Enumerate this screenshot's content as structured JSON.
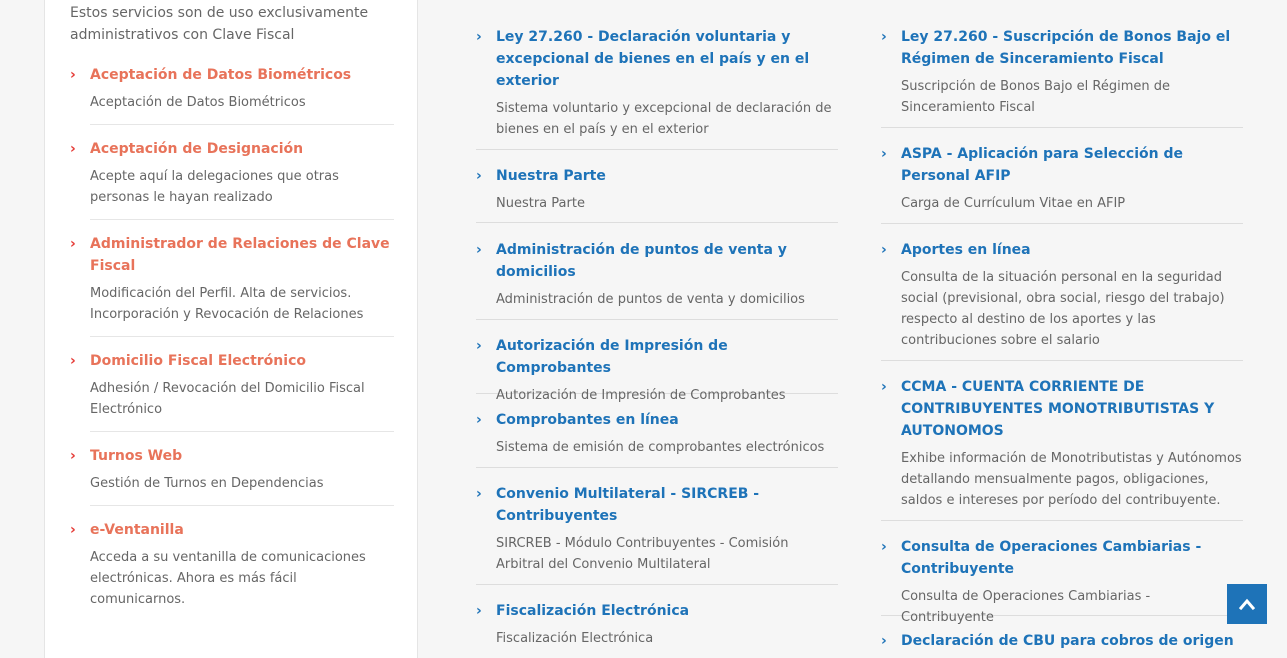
{
  "left_panel": {
    "intro": "Estos servicios son de uso exclusivamente administrativos con Clave Fiscal",
    "items": [
      {
        "title": "Aceptación de Datos Biométricos",
        "desc": "Aceptación de Datos Biométricos"
      },
      {
        "title": "Aceptación de Designación",
        "desc": "Acepte aquí la delegaciones que otras personas le hayan realizado"
      },
      {
        "title": "Administrador de Relaciones de Clave Fiscal",
        "desc": "Modificación del Perfil. Alta de servicios. Incorporación y Revocación de Relaciones"
      },
      {
        "title": "Domicilio Fiscal Electrónico",
        "desc": "Adhesión / Revocación del Domicilio Fiscal Electrónico"
      },
      {
        "title": "Turnos Web",
        "desc": "Gestión de Turnos en Dependencias"
      },
      {
        "title": "e-Ventanilla",
        "desc": "Acceda a su ventanilla de comunicaciones electrónicas. Ahora es más fácil comunicarnos."
      }
    ]
  },
  "middle_column": {
    "items": [
      {
        "title": "Ley 27.260 - Declaración voluntaria y excepcional de bienes en el país y en el exterior",
        "desc": "Sistema voluntario y excepcional de declaración de bienes en el país y en el exterior"
      },
      {
        "title": "Nuestra Parte",
        "desc": "Nuestra Parte"
      },
      {
        "title": "Administración de puntos de venta y domicilios",
        "desc": "Administración de puntos de venta y domicilios"
      },
      {
        "title": "Autorización de Impresión de Comprobantes",
        "desc": "Autorización de Impresión de Comprobantes"
      },
      {
        "title": "Comprobantes en línea",
        "desc": "Sistema de emisión de comprobantes electrónicos"
      },
      {
        "title": "Convenio Multilateral - SIRCREB - Contribuyentes",
        "desc": "SIRCREB - Módulo Contribuyentes - Comisión Arbitral del Convenio Multilateral"
      },
      {
        "title": "Fiscalización Electrónica",
        "desc": "Fiscalización Electrónica"
      }
    ]
  },
  "right_column": {
    "items": [
      {
        "title": "Ley 27.260 - Suscripción de Bonos Bajo el Régimen de Sinceramiento Fiscal",
        "desc": "Suscripción de Bonos Bajo el Régimen de Sinceramiento Fiscal"
      },
      {
        "title": "ASPA - Aplicación para Selección de Personal AFIP",
        "desc": "Carga de Currículum Vitae en AFIP"
      },
      {
        "title": "Aportes en línea",
        "desc": "Consulta de la situación personal en la seguridad social (previsional, obra social, riesgo del trabajo) respecto al destino de los aportes y las contribuciones sobre el salario"
      },
      {
        "title": "CCMA - CUENTA CORRIENTE DE CONTRIBUYENTES MONOTRIBUTISTAS Y AUTONOMOS",
        "desc": "Exhibe información de Monotributistas y Autónomos detallando mensualmente pagos, obligaciones, saldos e intereses por período del contribuyente."
      },
      {
        "title": "Consulta de Operaciones Cambiarias - Contribuyente",
        "desc": "Consulta de Operaciones Cambiarias - Contribuyente"
      },
      {
        "title": "Declaración de CBU para cobros de origen",
        "desc": ""
      }
    ]
  },
  "icons": {
    "chevron": "chevron-right-icon",
    "scroll_top": "arrow-up-icon"
  },
  "colors": {
    "left_title": "#e8735a",
    "left_chevron": "#e53935",
    "blue_title": "#1e73b8",
    "scroll_top_bg": "#1e73b8"
  }
}
